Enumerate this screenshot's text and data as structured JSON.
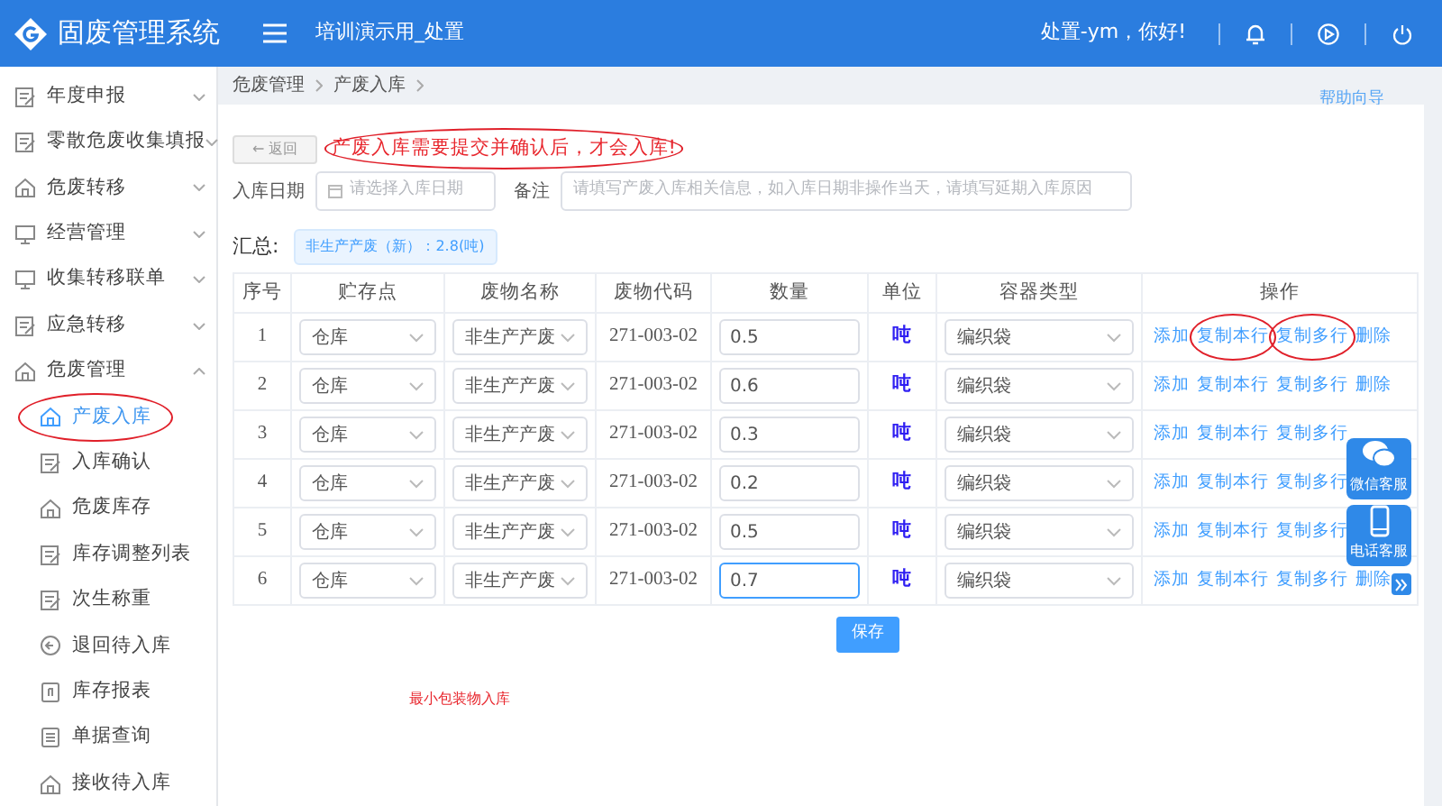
{
  "header": {
    "app_title": "固废管理系统",
    "org": "培训演示用_处置",
    "greeting": "处置-ym，你好!"
  },
  "sidebar": {
    "items": [
      {
        "label": "年度申报",
        "expanded": false
      },
      {
        "label": "零散危废收集填报",
        "expanded": false
      },
      {
        "label": "危废转移",
        "expanded": false
      },
      {
        "label": "经营管理",
        "expanded": false
      },
      {
        "label": "收集转移联单",
        "expanded": false
      },
      {
        "label": "应急转移",
        "expanded": false
      },
      {
        "label": "危废管理",
        "expanded": true,
        "children": [
          {
            "label": "产废入库",
            "selected": true,
            "circled": true
          },
          {
            "label": "入库确认",
            "selected": false,
            "circled": false
          },
          {
            "label": "危废库存",
            "selected": false,
            "circled": false
          },
          {
            "label": "库存调整列表",
            "selected": false,
            "circled": false
          },
          {
            "label": "次生称重",
            "selected": false,
            "circled": false
          },
          {
            "label": "退回待入库",
            "selected": false,
            "circled": false
          },
          {
            "label": "库存报表",
            "selected": false,
            "circled": false
          },
          {
            "label": "单据查询",
            "selected": false,
            "circled": false
          },
          {
            "label": "接收待入库",
            "selected": false,
            "circled": false
          }
        ]
      }
    ]
  },
  "breadcrumb": [
    "危废管理",
    "产废入库"
  ],
  "help_link": "帮助向导",
  "back_button": "← 返回",
  "notice": {
    "text": "产废入库需要提交并确认后，才会入库!",
    "circled": true
  },
  "form": {
    "date_label": "入库日期",
    "date_placeholder": "请选择入库日期",
    "remark_label": "备注",
    "remark_placeholder": "请填写产废入库相关信息，如入库日期非操作当天，请填写延期入库原因"
  },
  "summary": {
    "label": "汇总:",
    "tag": "非生产产废（新）：2.8(吨)"
  },
  "table": {
    "columns": [
      "序号",
      "贮存点",
      "废物名称",
      "废物代码",
      "数量",
      "单位",
      "容器类型",
      "操作"
    ],
    "rows": [
      {
        "no": "1",
        "storage": "仓库",
        "waste_name": "非生产产废",
        "code": "271-003-02",
        "quantity": "0.5",
        "focused": false,
        "unit": "吨",
        "container": "编织袋",
        "actions": [
          {
            "label": "添加",
            "circled": false
          },
          {
            "label": "复制本行",
            "circled": true
          },
          {
            "label": "复制多行",
            "circled": true
          },
          {
            "label": "删除",
            "circled": false
          }
        ]
      },
      {
        "no": "2",
        "storage": "仓库",
        "waste_name": "非生产产废",
        "code": "271-003-02",
        "quantity": "0.6",
        "focused": false,
        "unit": "吨",
        "container": "编织袋",
        "actions": [
          {
            "label": "添加",
            "circled": false
          },
          {
            "label": "复制本行",
            "circled": false
          },
          {
            "label": "复制多行",
            "circled": false
          },
          {
            "label": "删除",
            "circled": false
          }
        ]
      },
      {
        "no": "3",
        "storage": "仓库",
        "waste_name": "非生产产废",
        "code": "271-003-02",
        "quantity": "0.3",
        "focused": false,
        "unit": "吨",
        "container": "编织袋",
        "actions": [
          {
            "label": "添加",
            "circled": false
          },
          {
            "label": "复制本行",
            "circled": false
          },
          {
            "label": "复制多行",
            "circled": false
          }
        ]
      },
      {
        "no": "4",
        "storage": "仓库",
        "waste_name": "非生产产废",
        "code": "271-003-02",
        "quantity": "0.2",
        "focused": false,
        "unit": "吨",
        "container": "编织袋",
        "actions": [
          {
            "label": "添加",
            "circled": false
          },
          {
            "label": "复制本行",
            "circled": false
          },
          {
            "label": "复制多行",
            "circled": false
          }
        ]
      },
      {
        "no": "5",
        "storage": "仓库",
        "waste_name": "非生产产废",
        "code": "271-003-02",
        "quantity": "0.5",
        "focused": false,
        "unit": "吨",
        "container": "编织袋",
        "actions": [
          {
            "label": "添加",
            "circled": false
          },
          {
            "label": "复制本行",
            "circled": false
          },
          {
            "label": "复制多行",
            "circled": false
          }
        ]
      },
      {
        "no": "6",
        "storage": "仓库",
        "waste_name": "非生产产废",
        "code": "271-003-02",
        "quantity": "0.7",
        "focused": true,
        "unit": "吨",
        "container": "编织袋",
        "actions": [
          {
            "label": "添加",
            "circled": false
          },
          {
            "label": "复制本行",
            "circled": false
          },
          {
            "label": "复制多行",
            "circled": false
          },
          {
            "label": "删除",
            "circled": false
          }
        ]
      }
    ]
  },
  "save_button": "保存",
  "footer_note": "最小包装物入库",
  "service_panel": [
    {
      "kind": "wechat",
      "label": "微信客服"
    },
    {
      "kind": "phone",
      "label": "电话客服"
    }
  ]
}
